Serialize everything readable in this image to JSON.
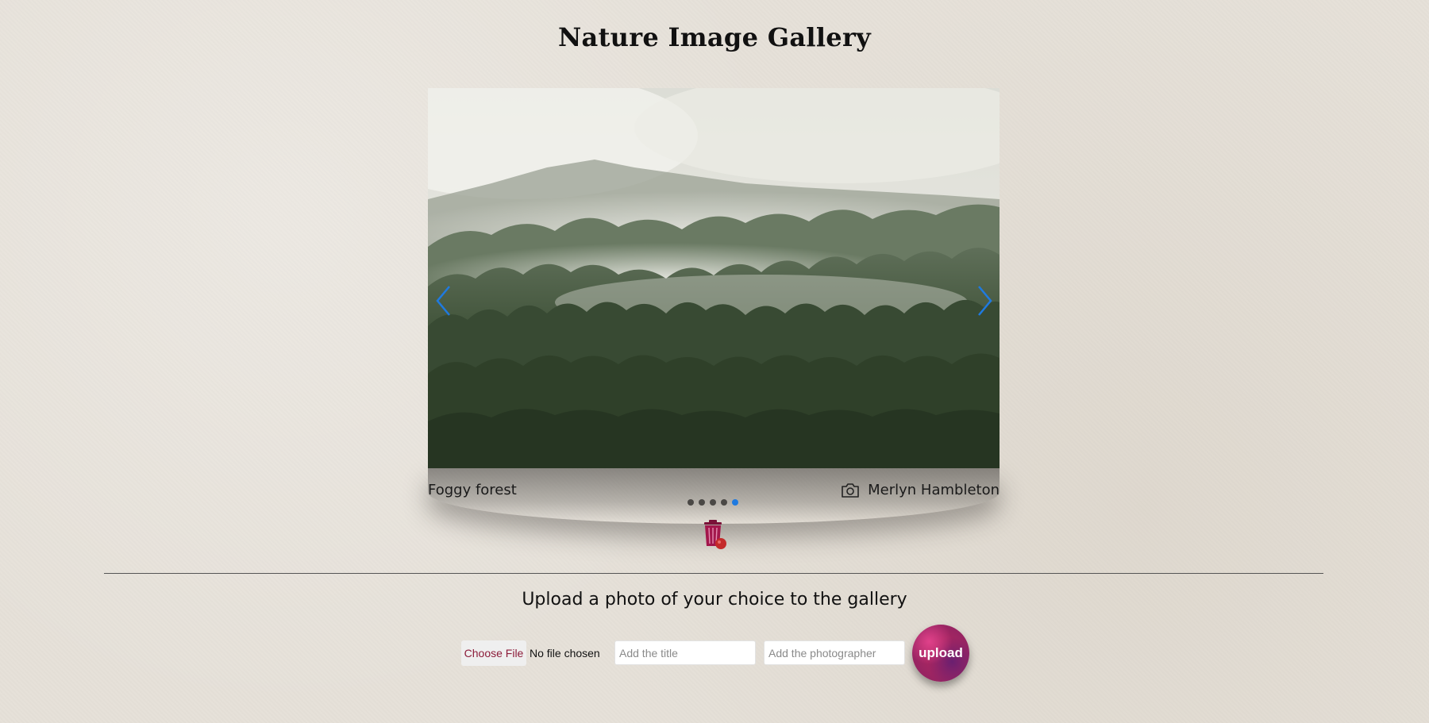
{
  "page": {
    "title": "Nature Image Gallery"
  },
  "gallery": {
    "current_image": {
      "title": "Foggy forest",
      "photographer": "Merlyn Hambleton"
    },
    "dots": [
      {
        "active": false
      },
      {
        "active": false
      },
      {
        "active": false
      },
      {
        "active": false
      },
      {
        "active": true
      }
    ],
    "icons": {
      "prev": "chevron-left-icon",
      "next": "chevron-right-icon",
      "photographer": "camera-icon",
      "delete": "trash-icon"
    },
    "colors": {
      "arrow": "#1f7ae0",
      "active_dot": "#1f7ae0",
      "inactive_dot": "#4a4845"
    }
  },
  "upload": {
    "heading": "Upload a photo of your choice to the gallery",
    "file_button_label": "Choose File",
    "file_status": "No file chosen",
    "title_placeholder": "Add the title",
    "photographer_placeholder": "Add the photographer",
    "submit_label": "upload"
  }
}
